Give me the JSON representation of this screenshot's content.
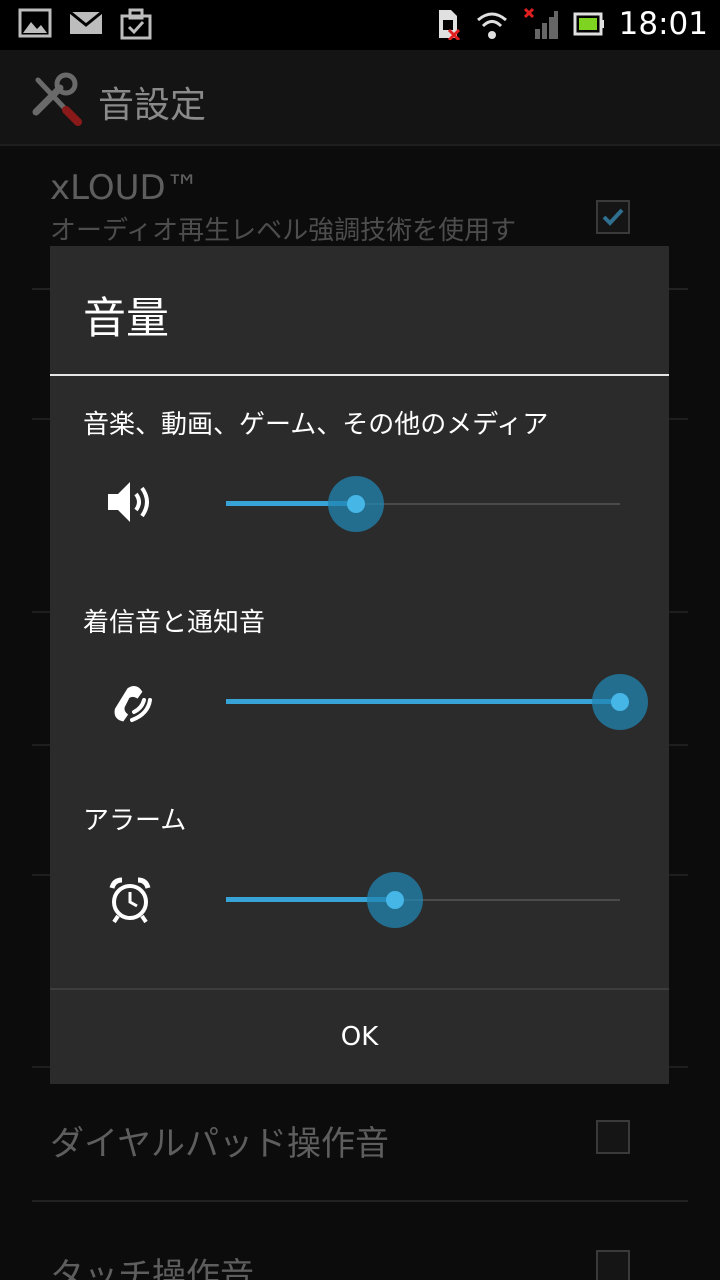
{
  "status_bar": {
    "time": "18:01",
    "left_icons": [
      "image-icon",
      "mail-icon",
      "task-icon"
    ],
    "right_icons": [
      "sim-error-icon",
      "wifi-icon",
      "signal-icon",
      "battery-icon"
    ]
  },
  "action_bar": {
    "icon": "wrench-icon",
    "title": "音設定"
  },
  "background_list": {
    "xloud": {
      "title": "xLOUD™",
      "subtitle": "オーディオ再生レベル強調技術を使用す",
      "checked": true
    },
    "dialpad": {
      "title": "ダイヤルパッド操作音",
      "checked": false
    },
    "touch": {
      "title": "タッチ操作音",
      "checked": false
    }
  },
  "dialog": {
    "title": "音量",
    "sections": [
      {
        "label": "音楽、動画、ゲーム、その他のメディア",
        "icon": "speaker-icon",
        "level": 0.33
      },
      {
        "label": "着信音と通知音",
        "icon": "phone-ring-icon",
        "level": 1.0
      },
      {
        "label": "アラーム",
        "icon": "alarm-clock-icon",
        "level": 0.43
      }
    ],
    "ok_label": "OK"
  },
  "colors": {
    "accent": "#37a3d6",
    "thumb_halo": "#2284b2",
    "dialog_bg": "#2b2b2b"
  }
}
